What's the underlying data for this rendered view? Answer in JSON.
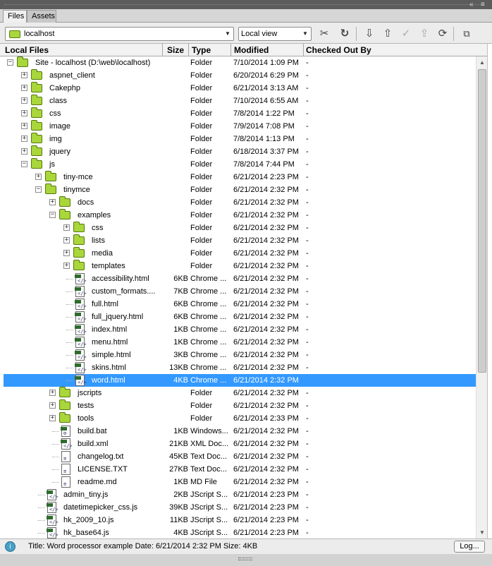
{
  "tabs": [
    {
      "label": "Files",
      "active": true
    },
    {
      "label": "Assets",
      "active": false
    }
  ],
  "toolbar": {
    "site": "localhost",
    "view": "Local view",
    "buttons": [
      "connect-icon",
      "refresh-icon",
      "get-icon",
      "put-icon",
      "check-out-icon",
      "check-in-icon",
      "synchronize-icon",
      "expand-icon"
    ]
  },
  "columns": {
    "local_files": "Local Files",
    "size": "Size",
    "type": "Type",
    "modified": "Modified",
    "checked_out_by": "Checked Out By"
  },
  "rows": [
    {
      "depth": 0,
      "expander": "minus",
      "kind": "folder",
      "name": "Site - localhost (D:\\web\\localhost)",
      "size": "",
      "type": "Folder",
      "modified": "7/10/2014 1:09 PM",
      "co": "-"
    },
    {
      "depth": 1,
      "expander": "plus",
      "kind": "folder",
      "name": "aspnet_client",
      "size": "",
      "type": "Folder",
      "modified": "6/20/2014 6:29 PM",
      "co": "-"
    },
    {
      "depth": 1,
      "expander": "plus",
      "kind": "folder",
      "name": "Cakephp",
      "size": "",
      "type": "Folder",
      "modified": "6/21/2014 3:13 AM",
      "co": "-"
    },
    {
      "depth": 1,
      "expander": "plus",
      "kind": "folder",
      "name": "class",
      "size": "",
      "type": "Folder",
      "modified": "7/10/2014 6:55 AM",
      "co": "-"
    },
    {
      "depth": 1,
      "expander": "plus",
      "kind": "folder",
      "name": "css",
      "size": "",
      "type": "Folder",
      "modified": "7/8/2014 1:22 PM",
      "co": "-"
    },
    {
      "depth": 1,
      "expander": "plus",
      "kind": "folder",
      "name": "image",
      "size": "",
      "type": "Folder",
      "modified": "7/9/2014 7:08 PM",
      "co": "-"
    },
    {
      "depth": 1,
      "expander": "plus",
      "kind": "folder",
      "name": "img",
      "size": "",
      "type": "Folder",
      "modified": "7/8/2014 1:13 PM",
      "co": "-"
    },
    {
      "depth": 1,
      "expander": "plus",
      "kind": "folder",
      "name": "jquery",
      "size": "",
      "type": "Folder",
      "modified": "6/18/2014 3:37 PM",
      "co": "-"
    },
    {
      "depth": 1,
      "expander": "minus",
      "kind": "folder",
      "name": "js",
      "size": "",
      "type": "Folder",
      "modified": "7/8/2014 7:44 PM",
      "co": "-"
    },
    {
      "depth": 2,
      "expander": "plus",
      "kind": "folder",
      "name": "tiny-mce",
      "size": "",
      "type": "Folder",
      "modified": "6/21/2014 2:23 PM",
      "co": "-"
    },
    {
      "depth": 2,
      "expander": "minus",
      "kind": "folder",
      "name": "tinymce",
      "size": "",
      "type": "Folder",
      "modified": "6/21/2014 2:32 PM",
      "co": "-"
    },
    {
      "depth": 3,
      "expander": "plus",
      "kind": "folder",
      "name": "docs",
      "size": "",
      "type": "Folder",
      "modified": "6/21/2014 2:32 PM",
      "co": "-"
    },
    {
      "depth": 3,
      "expander": "minus",
      "kind": "folder",
      "name": "examples",
      "size": "",
      "type": "Folder",
      "modified": "6/21/2014 2:32 PM",
      "co": "-"
    },
    {
      "depth": 4,
      "expander": "plus",
      "kind": "folder",
      "name": "css",
      "size": "",
      "type": "Folder",
      "modified": "6/21/2014 2:32 PM",
      "co": "-"
    },
    {
      "depth": 4,
      "expander": "plus",
      "kind": "folder",
      "name": "lists",
      "size": "",
      "type": "Folder",
      "modified": "6/21/2014 2:32 PM",
      "co": "-"
    },
    {
      "depth": 4,
      "expander": "plus",
      "kind": "folder",
      "name": "media",
      "size": "",
      "type": "Folder",
      "modified": "6/21/2014 2:32 PM",
      "co": "-"
    },
    {
      "depth": 4,
      "expander": "plus",
      "kind": "folder",
      "name": "templates",
      "size": "",
      "type": "Folder",
      "modified": "6/21/2014 2:32 PM",
      "co": "-"
    },
    {
      "depth": 4,
      "expander": "",
      "kind": "file",
      "name": "accessibility.html",
      "size": "6KB",
      "type": "Chrome ...",
      "modified": "6/21/2014 2:32 PM",
      "co": "-"
    },
    {
      "depth": 4,
      "expander": "",
      "kind": "file",
      "name": "custom_formats....",
      "size": "7KB",
      "type": "Chrome ...",
      "modified": "6/21/2014 2:32 PM",
      "co": "-"
    },
    {
      "depth": 4,
      "expander": "",
      "kind": "file",
      "name": "full.html",
      "size": "6KB",
      "type": "Chrome ...",
      "modified": "6/21/2014 2:32 PM",
      "co": "-"
    },
    {
      "depth": 4,
      "expander": "",
      "kind": "file",
      "name": "full_jquery.html",
      "size": "6KB",
      "type": "Chrome ...",
      "modified": "6/21/2014 2:32 PM",
      "co": "-"
    },
    {
      "depth": 4,
      "expander": "",
      "kind": "file",
      "name": "index.html",
      "size": "1KB",
      "type": "Chrome ...",
      "modified": "6/21/2014 2:32 PM",
      "co": "-"
    },
    {
      "depth": 4,
      "expander": "",
      "kind": "file",
      "name": "menu.html",
      "size": "1KB",
      "type": "Chrome ...",
      "modified": "6/21/2014 2:32 PM",
      "co": "-"
    },
    {
      "depth": 4,
      "expander": "",
      "kind": "file",
      "name": "simple.html",
      "size": "3KB",
      "type": "Chrome ...",
      "modified": "6/21/2014 2:32 PM",
      "co": "-"
    },
    {
      "depth": 4,
      "expander": "",
      "kind": "file",
      "name": "skins.html",
      "size": "13KB",
      "type": "Chrome ...",
      "modified": "6/21/2014 2:32 PM",
      "co": "-"
    },
    {
      "depth": 4,
      "expander": "",
      "kind": "file",
      "name": "word.html",
      "size": "4KB",
      "type": "Chrome ...",
      "modified": "6/21/2014 2:32 PM",
      "co": "",
      "selected": true
    },
    {
      "depth": 3,
      "expander": "plus",
      "kind": "folder",
      "name": "jscripts",
      "size": "",
      "type": "Folder",
      "modified": "6/21/2014 2:32 PM",
      "co": "-"
    },
    {
      "depth": 3,
      "expander": "plus",
      "kind": "folder",
      "name": "tests",
      "size": "",
      "type": "Folder",
      "modified": "6/21/2014 2:32 PM",
      "co": "-"
    },
    {
      "depth": 3,
      "expander": "plus",
      "kind": "folder",
      "name": "tools",
      "size": "",
      "type": "Folder",
      "modified": "6/21/2014 2:33 PM",
      "co": "-"
    },
    {
      "depth": 3,
      "expander": "",
      "kind": "bat",
      "name": "build.bat",
      "size": "1KB",
      "type": "Windows...",
      "modified": "6/21/2014 2:32 PM",
      "co": "-"
    },
    {
      "depth": 3,
      "expander": "",
      "kind": "file",
      "name": "build.xml",
      "size": "21KB",
      "type": "XML Doc...",
      "modified": "6/21/2014 2:32 PM",
      "co": "-"
    },
    {
      "depth": 3,
      "expander": "",
      "kind": "plain",
      "name": "changelog.txt",
      "size": "45KB",
      "type": "Text Doc...",
      "modified": "6/21/2014 2:32 PM",
      "co": "-"
    },
    {
      "depth": 3,
      "expander": "",
      "kind": "plain",
      "name": "LICENSE.TXT",
      "size": "27KB",
      "type": "Text Doc...",
      "modified": "6/21/2014 2:32 PM",
      "co": "-"
    },
    {
      "depth": 3,
      "expander": "",
      "kind": "plain",
      "name": "readme.md",
      "size": "1KB",
      "type": "MD File",
      "modified": "6/21/2014 2:32 PM",
      "co": "-"
    },
    {
      "depth": 2,
      "expander": "",
      "kind": "file",
      "name": "admin_tiny.js",
      "size": "2KB",
      "type": "JScript S...",
      "modified": "6/21/2014 2:23 PM",
      "co": "-"
    },
    {
      "depth": 2,
      "expander": "",
      "kind": "file",
      "name": "datetimepicker_css.js",
      "size": "39KB",
      "type": "JScript S...",
      "modified": "6/21/2014 2:23 PM",
      "co": "-"
    },
    {
      "depth": 2,
      "expander": "",
      "kind": "file",
      "name": "hk_2009_10.js",
      "size": "11KB",
      "type": "JScript S...",
      "modified": "6/21/2014 2:23 PM",
      "co": "-"
    },
    {
      "depth": 2,
      "expander": "",
      "kind": "file",
      "name": "hk_base64.js",
      "size": "4KB",
      "type": "JScript S...",
      "modified": "6/21/2014 2:23 PM",
      "co": "-"
    }
  ],
  "status": {
    "text": "Title: Word processor example  Date: 6/21/2014 2:32 PM  Size: 4KB",
    "log_label": "Log..."
  }
}
